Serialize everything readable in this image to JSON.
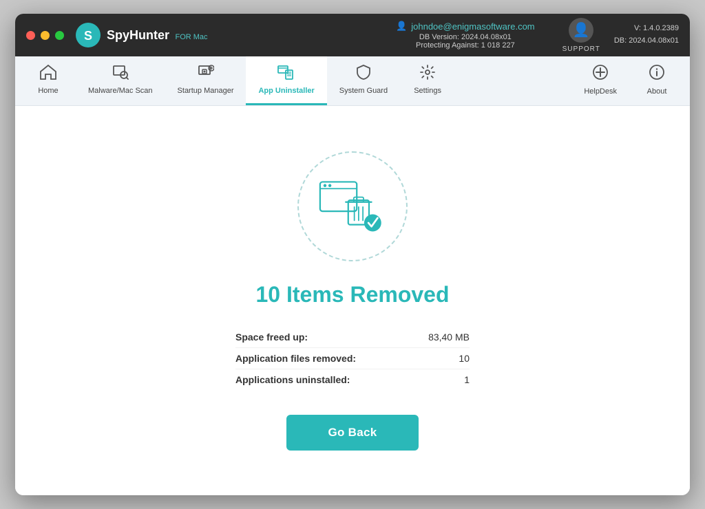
{
  "window": {
    "title": "SpyHunter for Mac"
  },
  "titlebar": {
    "app_name": "SpyHunter",
    "app_name_suffix": "FOR Mac",
    "user_email": "johndoe@enigmasoftware.com",
    "db_version_label": "DB Version: 2024.04.08x01",
    "protecting_label": "Protecting Against: 1 018 227",
    "support_label": "SUPPORT",
    "version_label": "V: 1.4.0.2389",
    "db_label": "DB:  2024.04.08x01"
  },
  "navbar": {
    "items": [
      {
        "id": "home",
        "label": "Home",
        "icon": "🏠"
      },
      {
        "id": "malware-scan",
        "label": "Malware/Mac Scan",
        "icon": "🔍"
      },
      {
        "id": "startup-manager",
        "label": "Startup Manager",
        "icon": "⚙"
      },
      {
        "id": "app-uninstaller",
        "label": "App Uninstaller",
        "icon": "📋",
        "active": true
      },
      {
        "id": "system-guard",
        "label": "System Guard",
        "icon": "🛡"
      },
      {
        "id": "settings",
        "label": "Settings",
        "icon": "⚙️"
      }
    ],
    "right_items": [
      {
        "id": "helpdesk",
        "label": "HelpDesk",
        "icon": "⊕"
      },
      {
        "id": "about",
        "label": "About",
        "icon": "ℹ"
      }
    ]
  },
  "main": {
    "result_title": "10 Items Removed",
    "stats": [
      {
        "label": "Space freed up:",
        "value": "83,40 MB"
      },
      {
        "label": "Application files removed:",
        "value": "10"
      },
      {
        "label": "Applications uninstalled:",
        "value": "1"
      }
    ],
    "go_back_button": "Go Back"
  }
}
